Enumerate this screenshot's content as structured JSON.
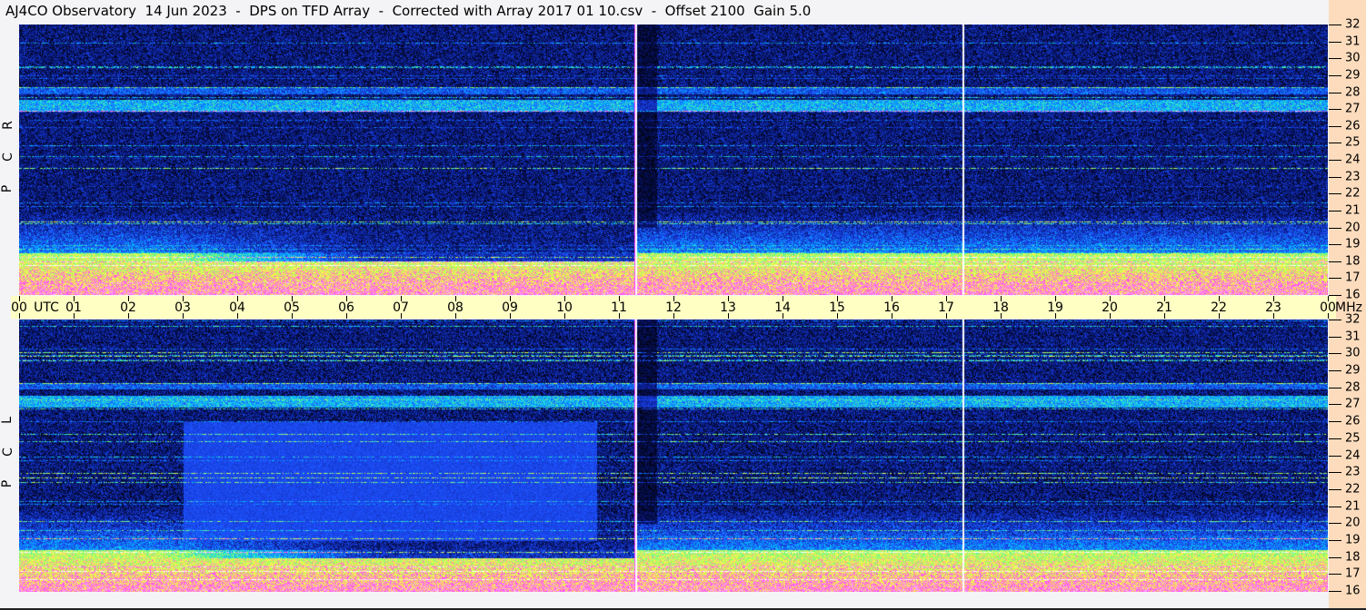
{
  "title": "AJ4CO Observatory  14 Jun 2023  -  DPS on TFD Array  -  Corrected with Array 2017 01 10.csv  -  Offset 2100  Gain 5.0",
  "chart_data": {
    "type": "heatmap",
    "title": "AJ4CO Observatory  14 Jun 2023  -  DPS on TFD Array  -  Corrected with Array 2017 01 10.csv  -  Offset 2100  Gain 5.0",
    "xlabel": "UTC",
    "ylabel": "MHz",
    "x_ticks": [
      "00",
      "01",
      "02",
      "03",
      "04",
      "05",
      "06",
      "07",
      "08",
      "09",
      "10",
      "11",
      "12",
      "13",
      "14",
      "15",
      "16",
      "17",
      "18",
      "19",
      "20",
      "21",
      "22",
      "23",
      "00"
    ],
    "xlim": [
      0,
      24
    ],
    "y_ticks": [
      "32",
      "31",
      "30",
      "29",
      "28",
      "27",
      "26",
      "25",
      "24",
      "23",
      "22",
      "21",
      "20",
      "19",
      "18",
      "17",
      "16"
    ],
    "ylim": [
      16,
      32
    ],
    "panels": [
      {
        "name": "RCP",
        "letters": [
          "R",
          "C",
          "P"
        ]
      },
      {
        "name": "LCP",
        "letters": [
          "L",
          "C",
          "P"
        ]
      }
    ],
    "gap_markers_utc": [
      11.3,
      17.3
    ],
    "colormap": [
      "#000000",
      "#0a1a8c",
      "#1e50ff",
      "#00c8ff",
      "#78ff78",
      "#ffff40",
      "#ff40ff",
      "#ffffff"
    ]
  }
}
